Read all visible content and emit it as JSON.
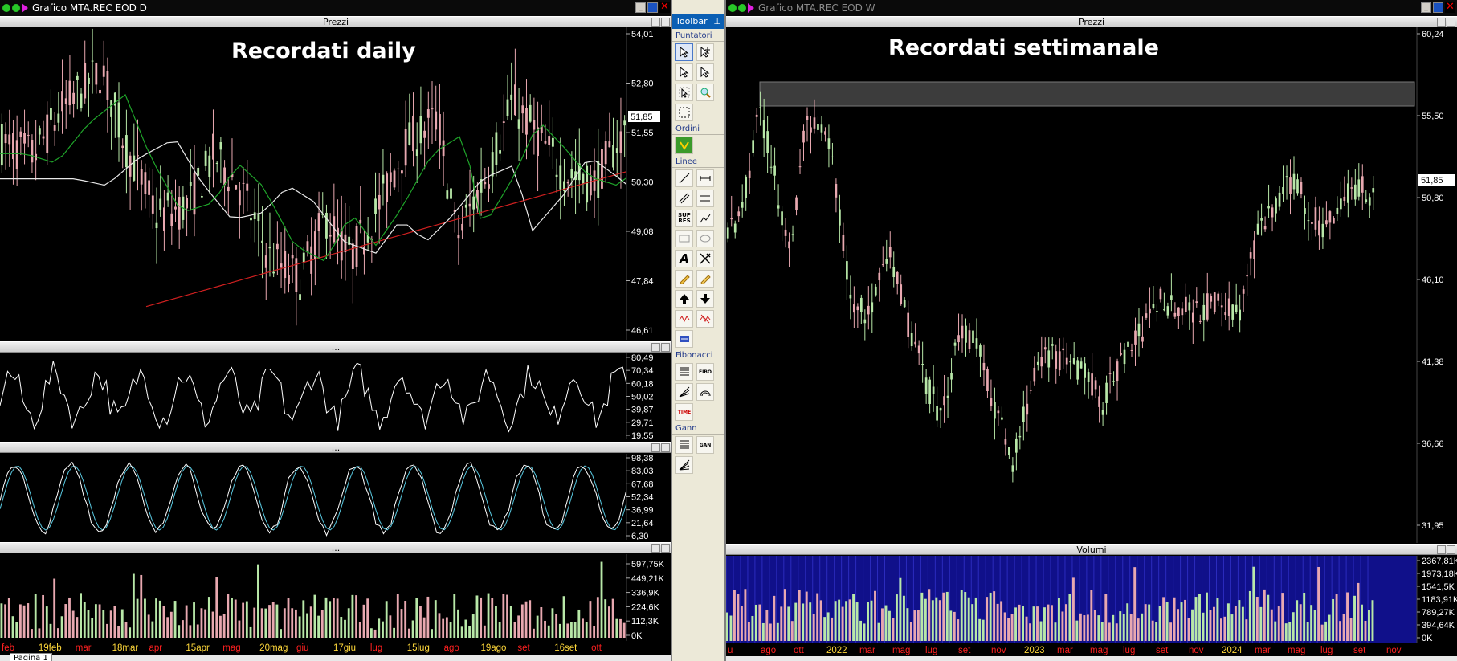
{
  "left": {
    "window_title": "Grafico MTA.REC EOD D",
    "overlay_title": "Recordati daily",
    "panes": {
      "prices": "Prezzi",
      "rsi": "...",
      "stoch": "...",
      "volume": "..."
    },
    "price_ticks": [
      "54,01",
      "52,80",
      "51,55",
      "50,30",
      "49,08",
      "47,84",
      "46,61"
    ],
    "last_price": "51,85",
    "rsi_ticks": [
      "80,49",
      "70,34",
      "60,18",
      "50,02",
      "39,87",
      "29,71",
      "19,55"
    ],
    "stoch_ticks": [
      "98,38",
      "83,03",
      "67,68",
      "52,34",
      "36,99",
      "21,64",
      "6,30"
    ],
    "volume_ticks": [
      "597,75K",
      "449,21K",
      "336,9K",
      "224,6K",
      "112,3K",
      "0K"
    ],
    "x_labels": [
      {
        "t": "feb",
        "c": "#ff2020"
      },
      {
        "t": "19feb",
        "c": "#ffd83a"
      },
      {
        "t": "mar",
        "c": "#ff2020"
      },
      {
        "t": "18mar",
        "c": "#ffd83a"
      },
      {
        "t": "apr",
        "c": "#ff2020"
      },
      {
        "t": "15apr",
        "c": "#ffd83a"
      },
      {
        "t": "mag",
        "c": "#ff2020"
      },
      {
        "t": "20mag",
        "c": "#ffd83a"
      },
      {
        "t": "giu",
        "c": "#ff2020"
      },
      {
        "t": "17giu",
        "c": "#ffd83a"
      },
      {
        "t": "lug",
        "c": "#ff2020"
      },
      {
        "t": "15lug",
        "c": "#ffd83a"
      },
      {
        "t": "ago",
        "c": "#ff2020"
      },
      {
        "t": "19ago",
        "c": "#ffd83a"
      },
      {
        "t": "set",
        "c": "#ff2020"
      },
      {
        "t": "16set",
        "c": "#ffd83a"
      },
      {
        "t": "ott",
        "c": "#ff2020"
      }
    ],
    "page_tab": "Pagina 1"
  },
  "right": {
    "window_title": "Grafico MTA.REC EOD W",
    "overlay_title": "Recordati settimanale",
    "panes": {
      "prices": "Prezzi",
      "volume": "Volumi"
    },
    "price_ticks": [
      "60,24",
      "55,50",
      "50,80",
      "46,10",
      "41,38",
      "36,66",
      "31,95"
    ],
    "last_price": "51,85",
    "volume_ticks": [
      "2367,81K",
      "1973,18K",
      "1541,5K",
      "1183,91K",
      "789,27K",
      "394,64K",
      "0K"
    ],
    "x_labels": [
      {
        "t": "u",
        "c": "#ff2020"
      },
      {
        "t": "ago",
        "c": "#ff2020"
      },
      {
        "t": "ott",
        "c": "#ff2020"
      },
      {
        "t": "2022",
        "c": "#ffd83a"
      },
      {
        "t": "mar",
        "c": "#ff2020"
      },
      {
        "t": "mag",
        "c": "#ff2020"
      },
      {
        "t": "lug",
        "c": "#ff2020"
      },
      {
        "t": "set",
        "c": "#ff2020"
      },
      {
        "t": "nov",
        "c": "#ff2020"
      },
      {
        "t": "2023",
        "c": "#ffd83a"
      },
      {
        "t": "mar",
        "c": "#ff2020"
      },
      {
        "t": "mag",
        "c": "#ff2020"
      },
      {
        "t": "lug",
        "c": "#ff2020"
      },
      {
        "t": "set",
        "c": "#ff2020"
      },
      {
        "t": "nov",
        "c": "#ff2020"
      },
      {
        "t": "2024",
        "c": "#ffd83a"
      },
      {
        "t": "mar",
        "c": "#ff2020"
      },
      {
        "t": "mag",
        "c": "#ff2020"
      },
      {
        "t": "lug",
        "c": "#ff2020"
      },
      {
        "t": "set",
        "c": "#ff2020"
      },
      {
        "t": "nov",
        "c": "#ff2020"
      }
    ]
  },
  "toolbar": {
    "title": "Toolbar",
    "groups": [
      "Puntatori",
      "Ordini",
      "Linee",
      "Fibonacci",
      "Gann"
    ],
    "label_sup_res": "SUP RES",
    "label_fibo": "FIBO",
    "label_time": "TIME",
    "label_gan": "GAN"
  },
  "colors": {
    "up": "#b8e8a8",
    "down": "#e8a8b0",
    "ma_fast": "#1fa52a",
    "ma_mid": "#e8e8e8",
    "ma_slow": "#d02020",
    "stoch_k": "#ffffff",
    "stoch_d": "#58c8e0",
    "volume_bg": "#10108a",
    "band": "#3c3c3c"
  }
}
